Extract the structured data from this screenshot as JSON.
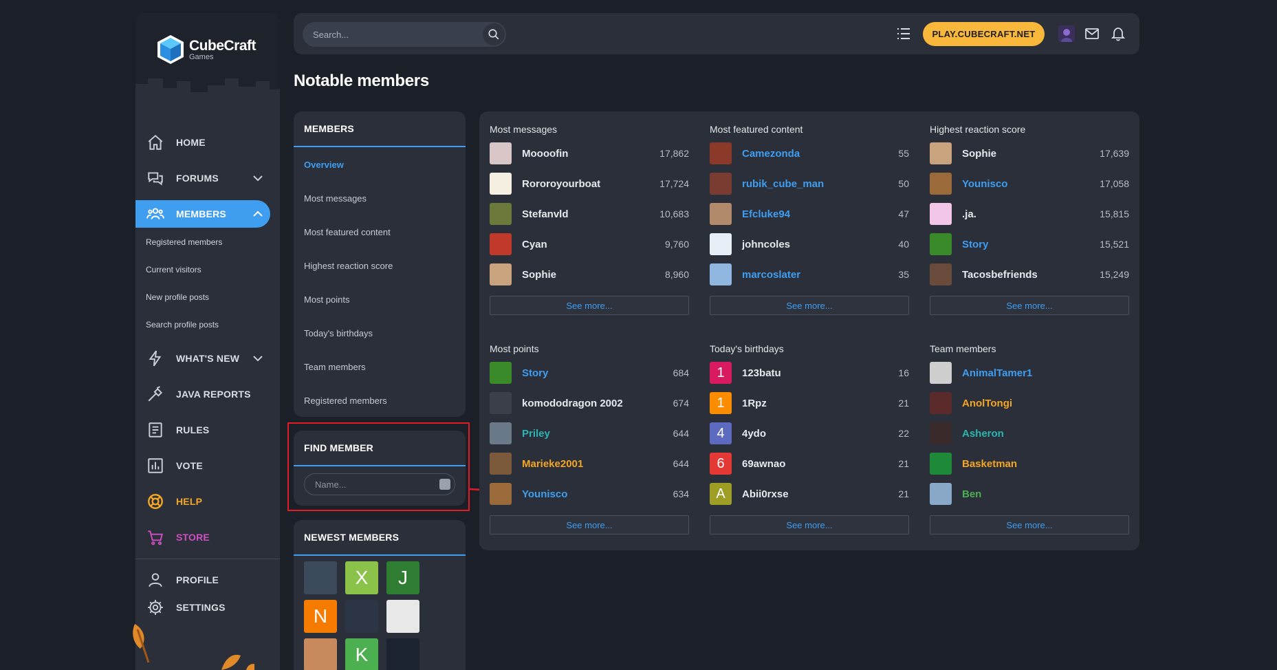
{
  "brand": {
    "name": "CubeCraft",
    "sub": "Games"
  },
  "sidebar": {
    "items": [
      {
        "label": "HOME",
        "icon": "home-icon"
      },
      {
        "label": "FORUMS",
        "icon": "chat-icon"
      },
      {
        "label": "MEMBERS",
        "icon": "users-icon"
      },
      {
        "label": "WHAT'S NEW",
        "icon": "bolt-icon"
      },
      {
        "label": "JAVA REPORTS",
        "icon": "hammer-icon"
      },
      {
        "label": "RULES",
        "icon": "book-icon"
      },
      {
        "label": "VOTE",
        "icon": "chart-icon"
      },
      {
        "label": "HELP",
        "icon": "lifebuoy-icon"
      },
      {
        "label": "STORE",
        "icon": "cart-icon"
      },
      {
        "label": "PROFILE",
        "icon": "user-icon"
      },
      {
        "label": "SETTINGS",
        "icon": "gear-icon"
      }
    ],
    "members_sub": [
      "Registered members",
      "Current visitors",
      "New profile posts",
      "Search profile posts"
    ],
    "colors": {
      "active": "#3f9ef0",
      "help": "#f5a623",
      "store": "#d04fc2"
    }
  },
  "topbar": {
    "search_placeholder": "Search...",
    "play_label": "PLAY.CUBECRAFT.NET"
  },
  "page": {
    "title": "Notable members"
  },
  "members_menu": {
    "heading": "MEMBERS",
    "links": [
      "Overview",
      "Most messages",
      "Most featured content",
      "Highest reaction score",
      "Most points",
      "Today's birthdays",
      "Team members",
      "Registered members"
    ]
  },
  "find_member": {
    "heading": "FIND MEMBER",
    "placeholder": "Name..."
  },
  "newest_members": {
    "heading": "NEWEST MEMBERS",
    "tiles": [
      {
        "letter": "",
        "color": "#3b4a5a"
      },
      {
        "letter": "X",
        "color": "#8bc34a"
      },
      {
        "letter": "J",
        "color": "#2e7d32"
      },
      {
        "letter": "N",
        "color": "#f57c00"
      },
      {
        "letter": "",
        "color": "#2b3546"
      },
      {
        "letter": "",
        "color": "#e8e8e8"
      },
      {
        "letter": "",
        "color": "#c98a5e"
      },
      {
        "letter": "K",
        "color": "#4caf50"
      },
      {
        "letter": "",
        "color": "#1c2330"
      }
    ]
  },
  "see_more": "See more...",
  "sections": [
    {
      "title": "Most messages",
      "rows": [
        {
          "name": "Moooofin",
          "value": "17,862",
          "color": "#e6e9ee",
          "avatar": "#d9c7c7",
          "letter": ""
        },
        {
          "name": "Rororoyourboat",
          "value": "17,724",
          "color": "#e6e9ee",
          "avatar": "#f4efe0",
          "letter": ""
        },
        {
          "name": "Stefanvld",
          "value": "10,683",
          "color": "#e6e9ee",
          "avatar": "#6b7a3a",
          "letter": ""
        },
        {
          "name": "Cyan",
          "value": "9,760",
          "color": "#e6e9ee",
          "avatar": "#c0392b",
          "letter": ""
        },
        {
          "name": "Sophie",
          "value": "8,960",
          "color": "#e6e9ee",
          "avatar": "#c9a27e",
          "letter": ""
        }
      ]
    },
    {
      "title": "Most featured content",
      "rows": [
        {
          "name": "Camezonda",
          "value": "55",
          "color": "#3f9ef0",
          "avatar": "#8b3a2a",
          "letter": ""
        },
        {
          "name": "rubik_cube_man",
          "value": "50",
          "color": "#3f9ef0",
          "avatar": "#7a3b30",
          "letter": ""
        },
        {
          "name": "Efcluke94",
          "value": "47",
          "color": "#3f9ef0",
          "avatar": "#b08a6a",
          "letter": ""
        },
        {
          "name": "johncoles",
          "value": "40",
          "color": "#e6e9ee",
          "avatar": "#e8eef5",
          "letter": ""
        },
        {
          "name": "marcoslater",
          "value": "35",
          "color": "#3f9ef0",
          "avatar": "#8fb7e0",
          "letter": ""
        }
      ]
    },
    {
      "title": "Highest reaction score",
      "rows": [
        {
          "name": "Sophie",
          "value": "17,639",
          "color": "#e6e9ee",
          "avatar": "#c9a27e",
          "letter": ""
        },
        {
          "name": "Younisco",
          "value": "17,058",
          "color": "#3f9ef0",
          "avatar": "#9a6a3a",
          "letter": ""
        },
        {
          "name": ".ja.",
          "value": "15,815",
          "color": "#e6e9ee",
          "avatar": "#f2c6e6",
          "letter": ""
        },
        {
          "name": "Story",
          "value": "15,521",
          "color": "#3f9ef0",
          "avatar": "#3a8a2a",
          "letter": ""
        },
        {
          "name": "Tacosbefriends",
          "value": "15,249",
          "color": "#e6e9ee",
          "avatar": "#6a4a3a",
          "letter": ""
        }
      ]
    },
    {
      "title": "Most points",
      "rows": [
        {
          "name": "Story",
          "value": "684",
          "color": "#3f9ef0",
          "avatar": "#3a8a2a",
          "letter": ""
        },
        {
          "name": "komododragon 2002",
          "value": "674",
          "color": "#e6e9ee",
          "avatar": "#3a3f4a",
          "letter": ""
        },
        {
          "name": "Priley",
          "value": "644",
          "color": "#2ab5b0",
          "avatar": "#6a7a8a",
          "letter": ""
        },
        {
          "name": "Marieke2001",
          "value": "644",
          "color": "#f5a623",
          "avatar": "#7a5a3a",
          "letter": ""
        },
        {
          "name": "Younisco",
          "value": "634",
          "color": "#3f9ef0",
          "avatar": "#9a6a3a",
          "letter": ""
        }
      ]
    },
    {
      "title": "Today's birthdays",
      "rows": [
        {
          "name": "123batu",
          "value": "16",
          "color": "#e6e9ee",
          "avatar": "#d81b60",
          "letter": "1"
        },
        {
          "name": "1Rpz",
          "value": "21",
          "color": "#e6e9ee",
          "avatar": "#fb8c00",
          "letter": "1"
        },
        {
          "name": "4ydo",
          "value": "22",
          "color": "#e6e9ee",
          "avatar": "#5c6bc0",
          "letter": "4"
        },
        {
          "name": "69awnao",
          "value": "21",
          "color": "#e6e9ee",
          "avatar": "#e53935",
          "letter": "6"
        },
        {
          "name": "Abii0rxse",
          "value": "21",
          "color": "#e6e9ee",
          "avatar": "#9e9d24",
          "letter": "A"
        }
      ]
    },
    {
      "title": "Team members",
      "rows": [
        {
          "name": "AnimalTamer1",
          "value": "",
          "color": "#3f9ef0",
          "avatar": "#cfcfcf",
          "letter": ""
        },
        {
          "name": "AnolTongi",
          "value": "",
          "color": "#f5a623",
          "avatar": "#5a2a2a",
          "letter": ""
        },
        {
          "name": "Asheron",
          "value": "",
          "color": "#2ab5b0",
          "avatar": "#3a2a2a",
          "letter": ""
        },
        {
          "name": "Basketman",
          "value": "",
          "color": "#f5a623",
          "avatar": "#1f8a3a",
          "letter": ""
        },
        {
          "name": "Ben",
          "value": "",
          "color": "#4caf50",
          "avatar": "#8aa8c8",
          "letter": ""
        }
      ]
    }
  ]
}
